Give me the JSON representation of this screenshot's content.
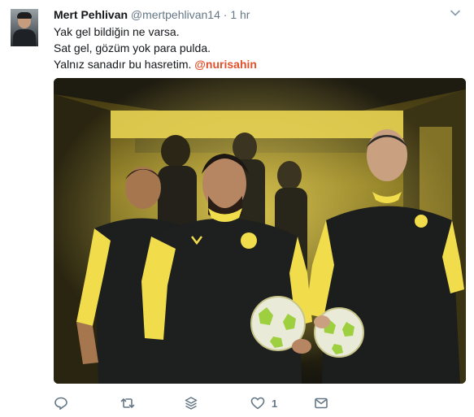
{
  "tweet": {
    "author_name": "Mert Pehlivan",
    "handle": "@mertpehlivan14",
    "separator": "·",
    "time": "1 hr",
    "lines": [
      "Yak gel bildiğin ne varsa.",
      "Sat gel, gözüm yok para pulda.",
      "Yalnız sanadır bu hasretim. "
    ],
    "mention": "@nurisahin",
    "like_count": "1"
  },
  "colors": {
    "mention": "#e0502b",
    "icon_gray": "#657786",
    "kit_yellow": "#f4e04d"
  },
  "icons": [
    "chevron-down-icon",
    "reply-icon",
    "retweet-icon",
    "stack-icon",
    "heart-icon",
    "message-icon"
  ]
}
